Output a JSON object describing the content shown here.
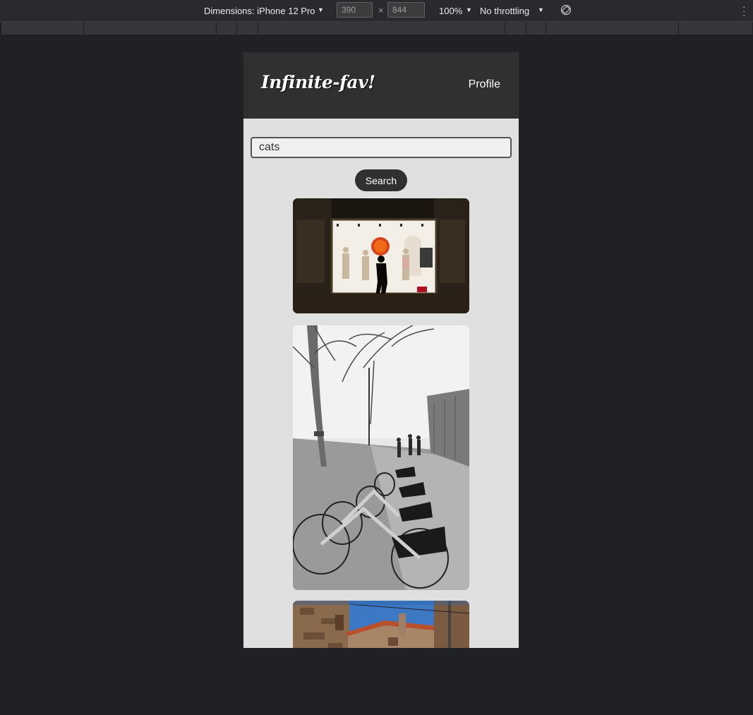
{
  "devtools": {
    "dimensions_label": "Dimensions: iPhone 12 Pro",
    "width_value": "390",
    "height_value": "844",
    "times_symbol": "×",
    "zoom_label": "100%",
    "throttle_label": "No throttling",
    "caret": "▼",
    "menu_glyph": "⋮"
  },
  "app": {
    "logo_text": "Infinite-fav!",
    "profile_label": "Profile",
    "search": {
      "value": "cats",
      "button_label": "Search"
    },
    "colors": {
      "header_bg": "#303030",
      "page_bg": "#e0e0e0",
      "button_bg": "#303030"
    },
    "images": [
      {
        "subject": "storefront window with mannequins and walking silhouette"
      },
      {
        "subject": "black-and-white row of rental bicycles on street"
      },
      {
        "subject": "stone village houses under blue sky"
      }
    ]
  }
}
